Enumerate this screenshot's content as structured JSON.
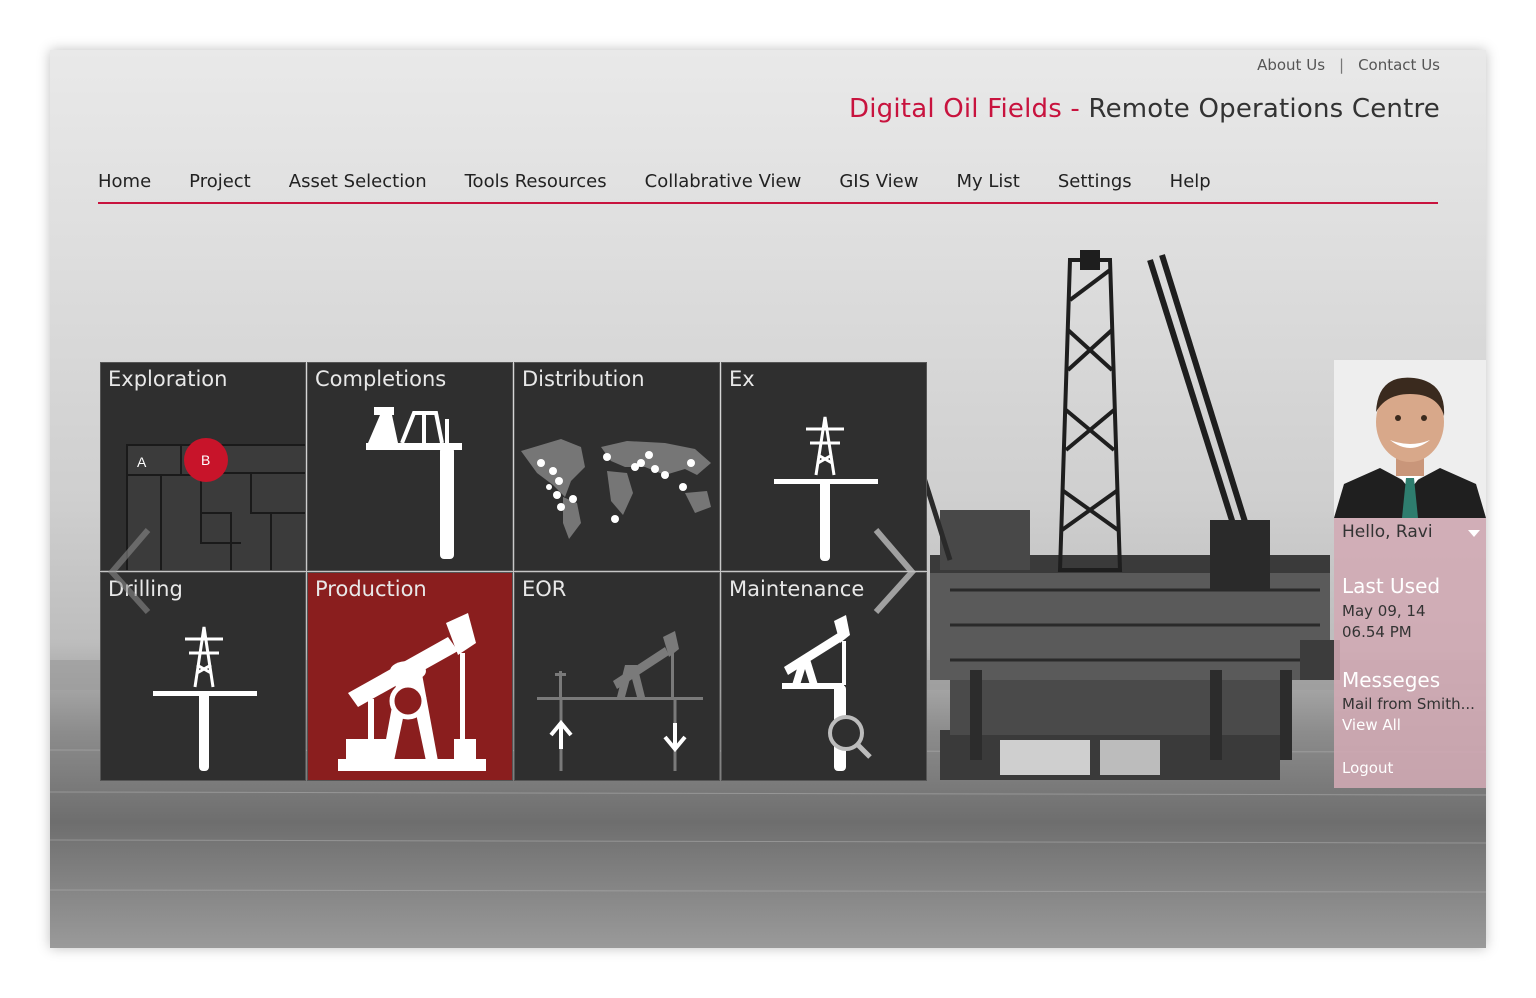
{
  "top_links": {
    "about": "About Us",
    "separator": "|",
    "contact": "Contact Us"
  },
  "brand": {
    "part1": "Digital Oil Fields",
    "dash": " - ",
    "part2": "Remote Operations Centre"
  },
  "nav": [
    "Home",
    "Project",
    "Asset Selection",
    "Tools Resources",
    "Collabrative View",
    "GIS View",
    "My List",
    "Settings",
    "Help"
  ],
  "tiles": [
    {
      "label": "Exploration",
      "icon": "map-icon",
      "markers": [
        "A",
        "B"
      ]
    },
    {
      "label": "Completions",
      "icon": "completion-rig-icon"
    },
    {
      "label": "Distribution",
      "icon": "world-map-icon"
    },
    {
      "label": "Ex",
      "icon": "pylon-icon"
    },
    {
      "label": "Drilling",
      "icon": "pylon-icon"
    },
    {
      "label": "Production",
      "icon": "pumpjack-icon",
      "selected": true
    },
    {
      "label": "EOR",
      "icon": "pumpjack-arrows-icon"
    },
    {
      "label": "Maintenance",
      "icon": "pumpjack-magnifier-icon"
    }
  ],
  "profile": {
    "greeting": "Hello, Ravi",
    "last_used_title": "Last Used",
    "last_used_date": "May 09, 14",
    "last_used_time": "06.54 PM",
    "messages_title": "Messeges",
    "message_preview": "Mail from Smith...",
    "view_all": "View All",
    "logout": "Logout"
  },
  "colors": {
    "accent": "#c8133e",
    "tile": "#2f2f2f",
    "tile_selected": "#8a1e1e",
    "profile_panel": "#d2aab4"
  }
}
